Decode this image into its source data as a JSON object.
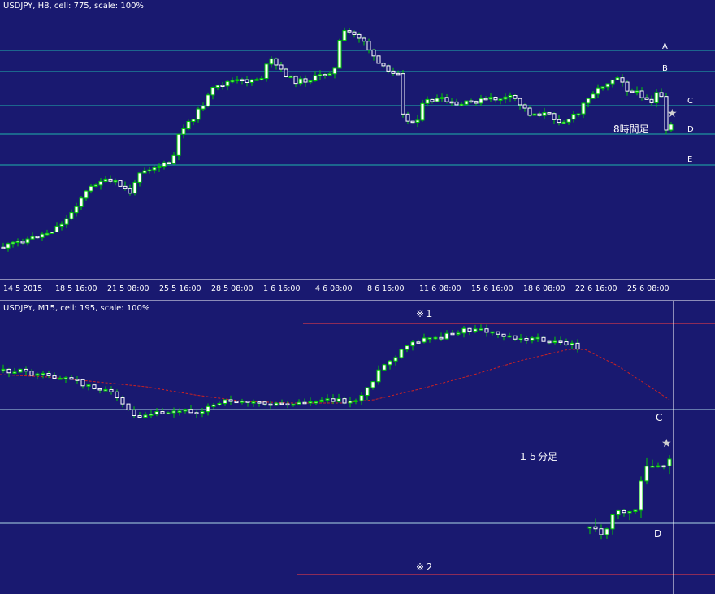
{
  "colors": {
    "background": "#191970",
    "up": "#ffffff",
    "down": "#ffffff",
    "wick": "#00d000",
    "hline_top": "#20b2aa",
    "hline_bottom": "#add8e6",
    "red_line": "#ff4040",
    "ma": "#cc2222"
  },
  "chart_data": [
    {
      "type": "candlestick",
      "header": "USDJPY, H8, cell: 775, scale: 100%",
      "timeframe_note": "8時間足",
      "star_icon": "star-icon",
      "x_ticks": [
        "14 5 2015",
        "18 5 16:00",
        "21 5 08:00",
        "25 5 16:00",
        "28 5 08:00",
        "1 6 16:00",
        "4 6 08:00",
        "8 6 16:00",
        "11 6 08:00",
        "15 6 16:00",
        "18 6 08:00",
        "22 6 16:00",
        "25 6 08:00"
      ],
      "levels": [
        {
          "label": "A"
        },
        {
          "label": "B"
        },
        {
          "label": "C"
        },
        {
          "label": "D"
        },
        {
          "label": "E"
        }
      ]
    },
    {
      "type": "candlestick",
      "header": "USDJPY, M15, cell: 195, scale: 100%",
      "timeframe_note": "１５分足",
      "star_icon": "star-icon",
      "levels": [
        {
          "label": "C"
        },
        {
          "label": "D"
        }
      ],
      "markers": [
        {
          "label": "※１"
        },
        {
          "label": "※２"
        }
      ],
      "series": [
        {
          "type": "moving-average",
          "style": "dashed"
        }
      ]
    }
  ]
}
